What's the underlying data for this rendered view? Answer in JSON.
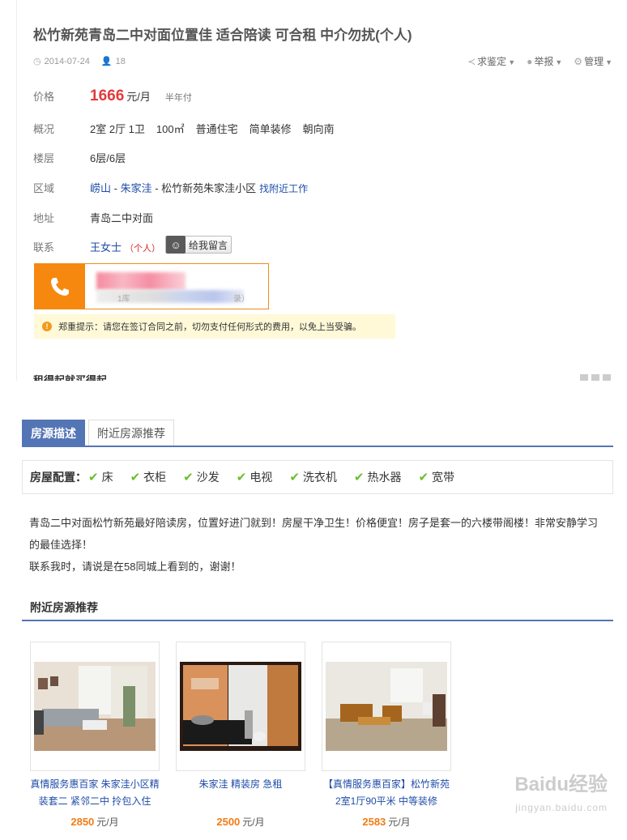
{
  "listing": {
    "title": "松竹新苑青岛二中对面位置佳 适合陪读 可合租 中介勿扰(个人)",
    "date": "2014-07-24",
    "views": "18",
    "tools": [
      "求鉴定",
      "举报",
      "管理"
    ]
  },
  "details": {
    "price_label": "价格",
    "price_value": "1666",
    "price_unit": "元/月",
    "price_payment": "半年付",
    "overview_label": "概况",
    "overview_items": [
      "2室 2厅 1卫",
      "100㎡",
      "普通住宅",
      "简单装修",
      "朝向南"
    ],
    "floor_label": "楼层",
    "floor_value": "6层/6层",
    "area_label": "区域",
    "area_district": "崂山",
    "area_sep1": " - ",
    "area_sub": "朱家洼",
    "area_rest": " - 松竹新苑朱家洼小区",
    "area_link": "找附近工作",
    "address_label": "地址",
    "address_value": "青岛二中对面",
    "contact_label": "联系",
    "contact_name": "王女士",
    "contact_type": "（个人）",
    "message_button": "给我留言"
  },
  "phone": {
    "hint_left": "1库",
    "hint_right": "录）"
  },
  "warning": "郑重提示：请您在签订合同之前，切勿支付任何形式的费用，以免上当受骗。",
  "cut_heading": "租得起就买得起",
  "tabs": [
    "房源描述",
    "附近房源推荐"
  ],
  "config": {
    "label": "房屋配置：",
    "items": [
      "床",
      "衣柜",
      "沙发",
      "电视",
      "洗衣机",
      "热水器",
      "宽带"
    ]
  },
  "description": {
    "line1": "青岛二中对面松竹新苑最好陪读房，位置好进门就到！房屋干净卫生！价格便宜！房子是套一的六楼带阁楼！非常安静学习的最佳选择！",
    "line2": "联系我时，请说是在58同城上看到的，谢谢！"
  },
  "nearby": {
    "title": "附近房源推荐",
    "cards": [
      {
        "title": "真情服务惠百家 朱家洼小区精装套二 紧邻二中 拎包入住",
        "price": "2850",
        "unit": "元/月"
      },
      {
        "title": "朱家洼 精装房 急租",
        "price": "2500",
        "unit": "元/月"
      },
      {
        "title": "【真情服务惠百家】松竹新苑 2室1厅90平米 中等装修",
        "price": "2583",
        "unit": "元/月"
      }
    ]
  },
  "watermark": {
    "brand": "Baidu经验",
    "url": "jingyan.baidu.com"
  },
  "colors": {
    "price": "#e4393c",
    "link": "#1f4da8",
    "accent": "#5475b5",
    "phone": "#f7880f",
    "check": "#6bbd2b"
  }
}
